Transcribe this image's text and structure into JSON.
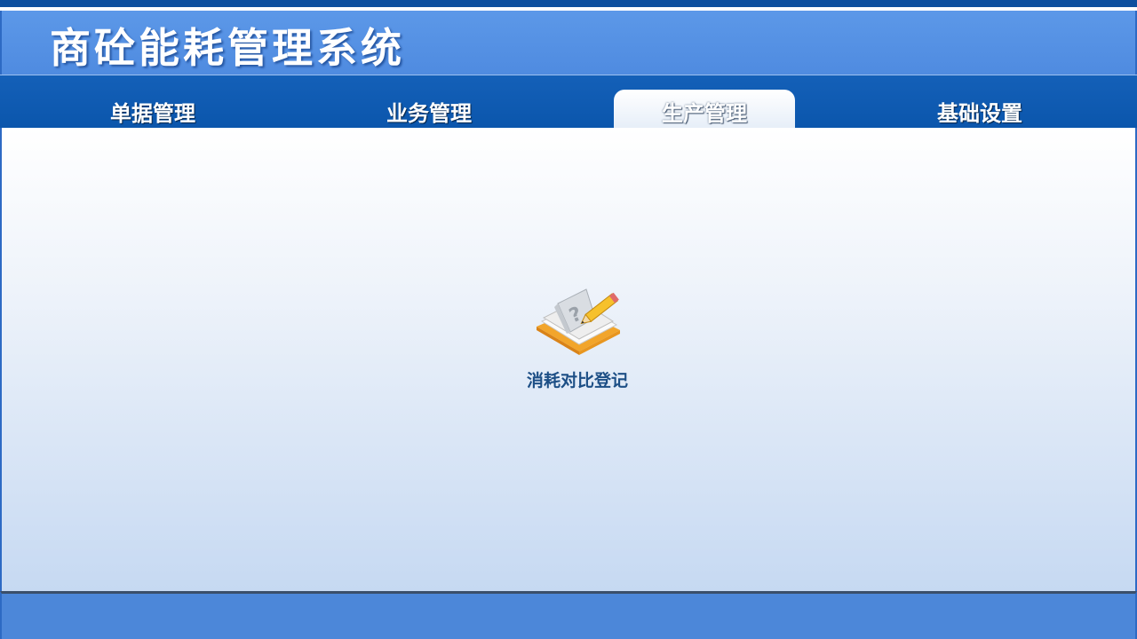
{
  "header": {
    "title": "商砼能耗管理系统"
  },
  "nav": {
    "tabs": [
      {
        "label": "单据管理"
      },
      {
        "label": "业务管理"
      },
      {
        "label": "生产管理",
        "active": true
      },
      {
        "label": "基础设置"
      }
    ]
  },
  "main": {
    "launchers": [
      {
        "label": "消耗对比登记",
        "icon": "notebook-pencil-icon"
      }
    ]
  },
  "colors": {
    "banner": "#5c98e8",
    "navbar": "#0b56ac",
    "footer": "#4c87d9",
    "label": "#1d4f86"
  }
}
